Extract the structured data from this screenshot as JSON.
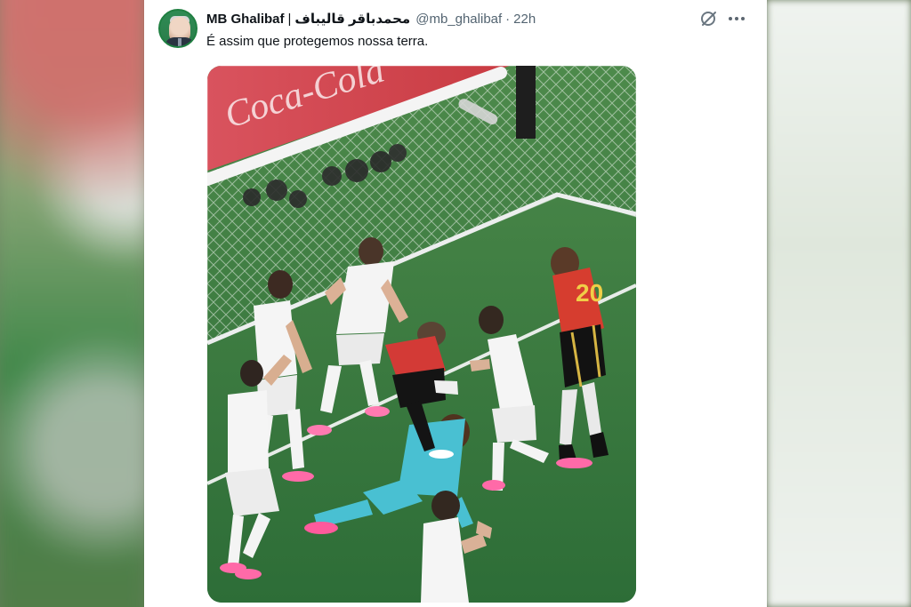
{
  "post": {
    "display_name": "MB Ghalibaf",
    "separator": "|",
    "rtl_name": "محمدباقر قالیباف",
    "handle": "@mb_ghalibaf",
    "dot": "·",
    "time": "22h",
    "text": "É assim que protegemos nossa terra."
  },
  "image_text": {
    "banner": "Coca-Cola",
    "back_number": "20"
  },
  "icons": {
    "avatar": "profile-photo",
    "grok": "grok-icon",
    "more": "more-icon"
  },
  "colors": {
    "primary_text": "#0f1419",
    "secondary_text": "#536471",
    "card_bg": "#ffffff",
    "pitch_green": "#2f7a3c",
    "red_kit": "#d63d2f",
    "teal_keeper": "#48bfd3"
  }
}
